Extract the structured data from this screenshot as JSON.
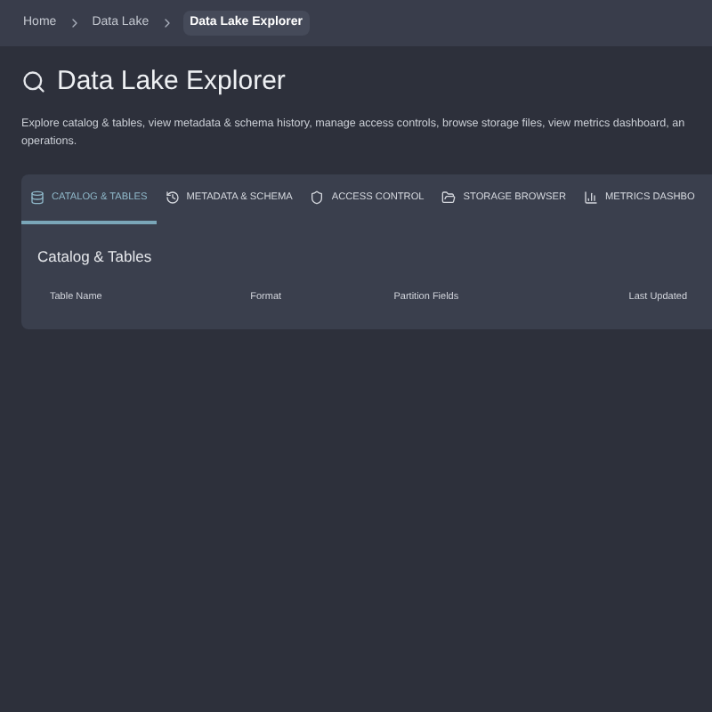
{
  "breadcrumb": [
    {
      "label": "Home",
      "selected": false
    },
    {
      "label": "Data Lake",
      "selected": false
    },
    {
      "label": "Data Lake Explorer",
      "selected": true
    }
  ],
  "title": "Data Lake Explorer",
  "description": [
    "Explore catalog & tables, view metadata & schema history, manage access controls, browse storage files, view metrics dashboard, an",
    "operations."
  ],
  "tabs": [
    {
      "label": "CATALOG & TABLES",
      "kind": "database",
      "selected": true
    },
    {
      "label": "METADATA & SCHEMA",
      "kind": "history",
      "selected": false
    },
    {
      "label": "ACCESS CONTROL",
      "kind": "shield",
      "selected": false
    },
    {
      "label": "STORAGE BROWSER",
      "kind": "folder",
      "selected": false
    },
    {
      "label": "METRICS DASHBO",
      "kind": "chart",
      "selected": false
    }
  ],
  "panel": {
    "title": "Catalog & Tables",
    "columns": [
      "Table Name",
      "Format",
      "Partition Fields",
      "Last Updated"
    ]
  }
}
